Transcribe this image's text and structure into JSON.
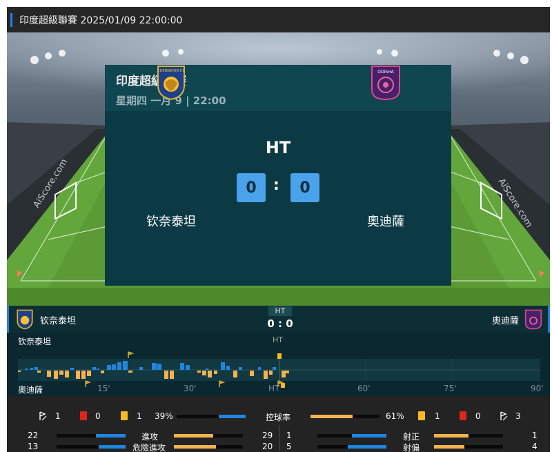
{
  "header": {
    "title": "印度超級聯賽 2025/01/09 22:00:00"
  },
  "match": {
    "league": "印度超級聯賽",
    "date_line": "星期四 一月 9 | 22:00",
    "status": "HT",
    "home": {
      "name": "钦奈泰坦",
      "score": "0",
      "logo_text": "CHENNAIYIN F.C",
      "color": "#1f3f8a"
    },
    "away": {
      "name": "奧迪薩",
      "score": "0",
      "logo_text": "ODISHA",
      "color": "#4a1f6a"
    },
    "colon": ":",
    "score_text": "0 : 0"
  },
  "watermark": "AiScore.com",
  "carousel": {
    "count": 4,
    "active": 0
  },
  "timeline": {
    "home_label": "钦奈泰坦",
    "away_label": "奧迪薩",
    "ht_label": "HT",
    "ticks": [
      "15'",
      "30'",
      "HT",
      "60'",
      "75'",
      "90'"
    ]
  },
  "stats": {
    "home_corners": "1",
    "home_red": "0",
    "home_yellow": "1",
    "possession_label": "控球率",
    "home_possession": "39%",
    "away_possession": "61%",
    "home_possession_value": 39,
    "away_possession_value": 61,
    "away_yellow": "1",
    "away_red": "0",
    "away_corners": "3",
    "attacks_label": "進攻",
    "home_attacks": "22",
    "away_attacks": "29",
    "dangerous_label": "危險進攻",
    "home_dangerous": "13",
    "away_dangerous": "20",
    "on_target_label": "射正",
    "home_on_target": "1",
    "away_on_target": "1",
    "off_target_label": "射偏",
    "home_off_target": "5",
    "away_off_target": "4"
  },
  "colors": {
    "accent": "#2b7de0",
    "home_bar": "#1f86e0",
    "away_bar": "#f4b24f",
    "score_box": "#4aa3ea",
    "red_card": "#e0241a",
    "yellow_card": "#f7b822"
  }
}
